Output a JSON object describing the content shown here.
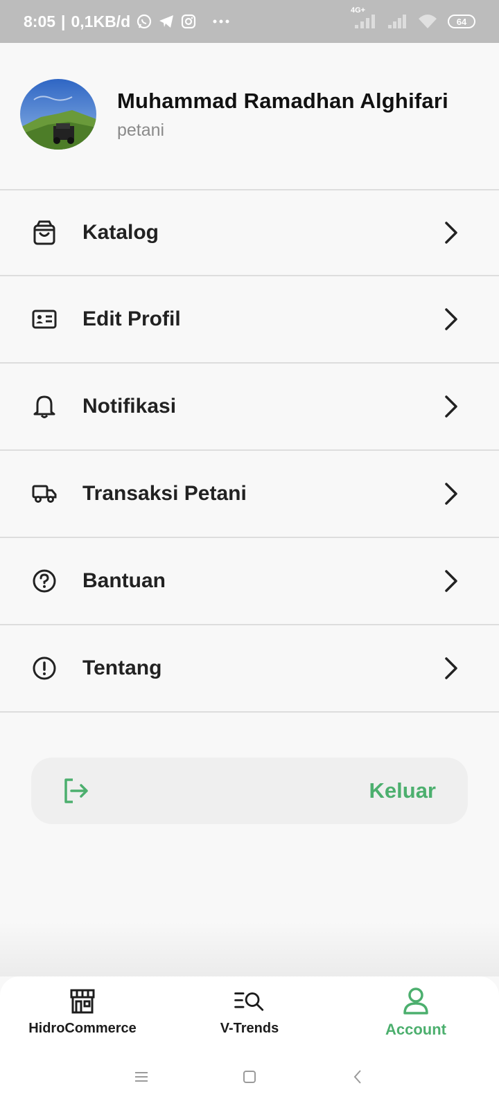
{
  "status_bar": {
    "time": "8:05",
    "net_speed": "0,1KB/d",
    "network_type": "4G+",
    "battery": "64",
    "icons": [
      "whatsapp-icon",
      "telegram-icon",
      "instagram-icon",
      "more-dots-icon",
      "signal-icon",
      "signal-icon",
      "wifi-icon",
      "battery-icon"
    ]
  },
  "profile": {
    "name": "Muhammad Ramadhan Alghifari",
    "role": "petani"
  },
  "menu": {
    "items": [
      {
        "label": "Katalog",
        "icon": "shopping-bag-icon"
      },
      {
        "label": "Edit Profil",
        "icon": "id-card-icon"
      },
      {
        "label": "Notifikasi",
        "icon": "bell-icon"
      },
      {
        "label": "Transaksi Petani",
        "icon": "truck-icon"
      },
      {
        "label": "Bantuan",
        "icon": "help-circle-icon"
      },
      {
        "label": "Tentang",
        "icon": "info-circle-icon"
      }
    ]
  },
  "logout": {
    "label": "Keluar",
    "icon": "logout-icon"
  },
  "bottom_nav": {
    "items": [
      {
        "label": "HidroCommerce",
        "icon": "store-icon",
        "active": false
      },
      {
        "label": "V-Trends",
        "icon": "search-list-icon",
        "active": false
      },
      {
        "label": "Account",
        "icon": "user-icon",
        "active": true
      }
    ]
  },
  "colors": {
    "accent": "#4caf6e",
    "status_bar": "#bcbcbc",
    "background": "#f8f8f8",
    "text": "#222222",
    "subtext": "#8a8a8a"
  }
}
